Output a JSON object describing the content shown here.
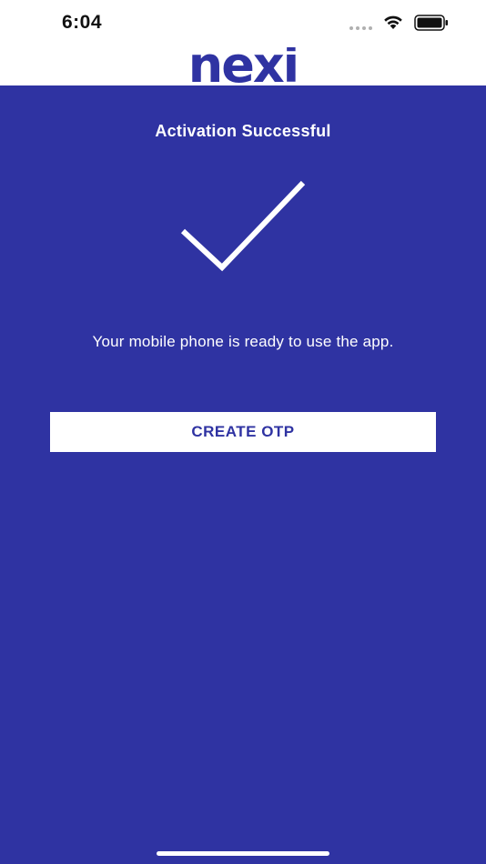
{
  "status_bar": {
    "time": "6:04"
  },
  "header": {
    "logo": "nexi"
  },
  "main": {
    "title": "Activation Successful",
    "message": "Your mobile phone is ready to use the app.",
    "button_label": "CREATE OTP"
  },
  "icons": {
    "check": "checkmark-icon",
    "wifi": "wifi-icon",
    "battery": "battery-icon",
    "signal": "signal-icon"
  },
  "colors": {
    "brand": "#2f33a2",
    "background": "#2f33a2",
    "header_bg": "#ffffff",
    "button_bg": "#ffffff",
    "text_on_brand": "#ffffff"
  }
}
